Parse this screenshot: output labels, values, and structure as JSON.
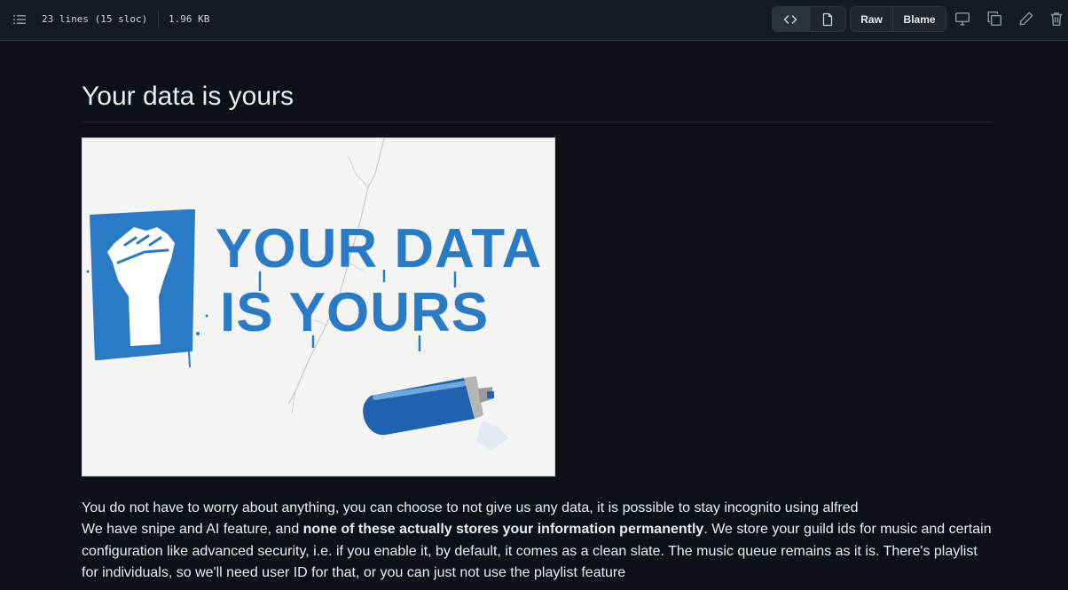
{
  "toolbar": {
    "lines_info": "23 lines (15 sloc)",
    "file_size": "1.96 KB",
    "raw_label": "Raw",
    "blame_label": "Blame"
  },
  "readme": {
    "heading": "Your data is yours",
    "hero_image_text": [
      "YOUR DATA",
      "IS YOURS"
    ],
    "line1": "You do not have to worry about anything, you can choose to not give us any data, it is possible to stay incognito using alfred",
    "line2_prefix": "We have snipe and AI feature, and ",
    "line2_bold": "none of these actually stores your information permanently",
    "line2_suffix": ". We store your guild ids for music and certain configuration like advanced security, i.e. if you enable it, by default, it comes as a clean slate. The music queue remains as it is. There's playlist for individuals, so we'll need user ID for that, or you can just not use the playlist feature"
  },
  "colors": {
    "background": "#0d1117",
    "toolbar": "#161b22",
    "accent_blue": "#2a7bc6"
  }
}
